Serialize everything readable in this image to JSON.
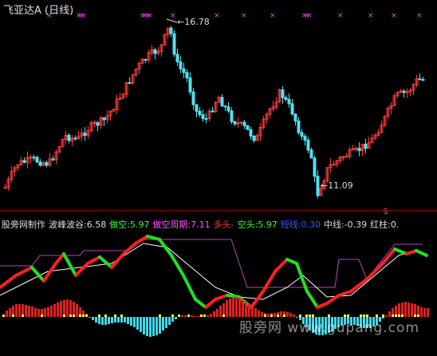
{
  "window": {
    "title": "飞亚达A (日线)"
  },
  "price_panel": {
    "peak_label": "16.78",
    "trough_label": "11.09",
    "peak_value": 16.78,
    "trough_value": 11.09,
    "colors": {
      "up": "#ff3c3c",
      "down": "#54e0f0",
      "marker": "#ff40ff"
    }
  },
  "indicator_row": [
    {
      "text": "股旁网制作",
      "color": "#dddddd"
    },
    {
      "text": "波峰波谷:6.58",
      "color": "#dddddd"
    },
    {
      "text": "做空:5.97",
      "color": "#33ff33"
    },
    {
      "text": "做空周期:7.11",
      "color": "#ff55ff"
    },
    {
      "text": "多头-",
      "color": "#ff3333"
    },
    {
      "text": "空头:5.97",
      "color": "#33ff33"
    },
    {
      "text": "短线:0.30",
      "color": "#3355ff"
    },
    {
      "text": "中线:-0.39",
      "color": "#dddddd"
    },
    {
      "text": "红柱:0.",
      "color": "#dddddd"
    }
  ],
  "watermark": {
    "text": "股旁网 www.gupang.com"
  }
}
